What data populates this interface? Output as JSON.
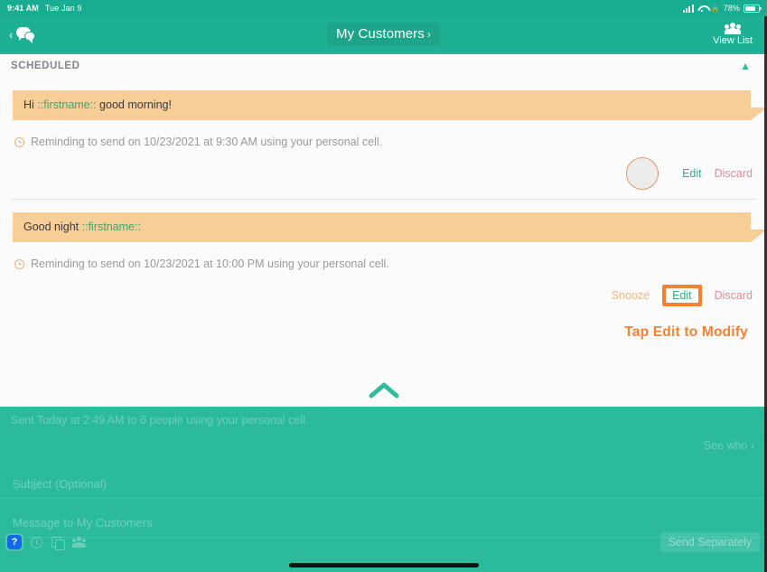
{
  "status_bar": {
    "time": "9:41 AM",
    "date": "Tue Jan 9",
    "battery_percent": "78%",
    "icons": [
      "signal-bars-icon",
      "wifi-icon",
      "lock-icon",
      "battery-icon"
    ]
  },
  "nav": {
    "back_chevron": "‹",
    "messages_icon": "chat-bubbles-icon",
    "title": "My Customers",
    "title_chevron": "›",
    "right_label": "View List",
    "right_icon": "people-group-icon"
  },
  "panel": {
    "section_title": "SCHEDULED",
    "collapse_icon": "chevron-up-icon",
    "collapse_big_icon": "chevron-up-large-icon"
  },
  "messages": [
    {
      "text_prefix": "Hi ",
      "variable": "::firstname::",
      "text_suffix": " good morning!",
      "reminder": "Reminding to send on 10/23/2021 at 9:30 AM using your personal cell.",
      "reminder_icon": "alarm-clock-icon",
      "avatar": "contact-avatar",
      "actions": {
        "edit": "Edit",
        "discard": "Discard"
      }
    },
    {
      "text_prefix": "Good night ",
      "variable": "::firstname::",
      "text_suffix": "",
      "reminder": "Reminding to send on 10/23/2021 at 10:00 PM using your personal cell.",
      "reminder_icon": "alarm-clock-icon",
      "actions": {
        "snooze": "Snooze",
        "edit": "Edit",
        "discard": "Discard"
      }
    }
  ],
  "callout": {
    "text": "Tap Edit to Modify",
    "highlight_target": "Edit"
  },
  "composer": {
    "sent_line": "Sent Today at 2:49 AM to 6 people using your personal cell.",
    "see_who": "See who ›",
    "subject_placeholder": "Subject (Optional)",
    "message_placeholder": "Message to My Customers",
    "send_button": "Send Separately",
    "toolbar_icons": [
      "help-question-icon",
      "clock-icon",
      "copy-icon",
      "group-icon"
    ],
    "help_badge": "?"
  },
  "colors": {
    "brand_teal": "#2bba9c",
    "nav_teal": "#1eb094",
    "bubble_orange": "#f7cd98",
    "variable_green": "#39a96f",
    "edit_green": "#3aa98e",
    "discard_pink": "#e28a9a",
    "snooze_orange": "#f2b87c",
    "callout_orange": "#f58233",
    "help_blue": "#1168e8"
  }
}
